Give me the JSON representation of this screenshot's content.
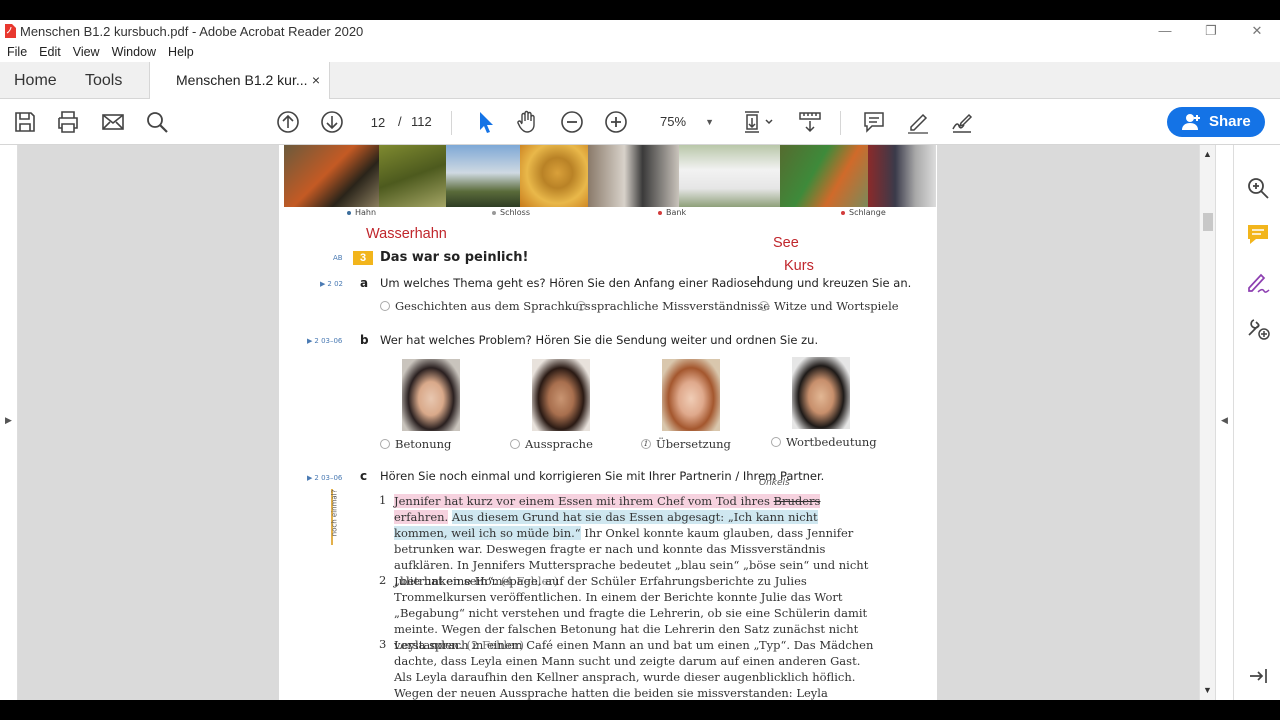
{
  "window": {
    "title": "Menschen B1.2 kursbuch.pdf - Adobe Acrobat Reader 2020",
    "controls": {
      "minimize": "—",
      "restore": "❐",
      "close": "✕"
    }
  },
  "menu": [
    "File",
    "Edit",
    "View",
    "Window",
    "Help"
  ],
  "tabs": {
    "home": "Home",
    "tools": "Tools",
    "document": "Menschen B1.2 kur...",
    "close": "×"
  },
  "toolbar": {
    "page_current": "12",
    "page_separator": "/",
    "page_total": "112",
    "zoom": "75%",
    "zoom_caret": "▼",
    "share_label": "Share",
    "icons": [
      "save-icon",
      "print-icon",
      "email-icon",
      "search-icon",
      "page-up-icon",
      "page-down-icon",
      "select-cursor-icon",
      "hand-tool-icon",
      "zoom-out-icon",
      "zoom-in-icon",
      "fit-page-icon",
      "scroll-mode-icon",
      "comment-icon",
      "highlight-pen-icon",
      "sign-icon"
    ]
  },
  "right_panel": {
    "icons": [
      "zoom-icon",
      "comment-panel-icon",
      "fill-sign-icon",
      "tools-icon",
      "collapse-panel-icon"
    ]
  },
  "colors": {
    "share_blue": "#1473e6",
    "annotation_red": "#c0262c",
    "exercise_orange": "#f2b51c",
    "highlight_pink": "#f6d2df",
    "highlight_blue": "#cfe7f0"
  },
  "document": {
    "photo_captions": [
      "Hahn",
      "Schloss",
      "Bank",
      "Schlange"
    ],
    "annotations": {
      "wasserhahn": "Wasserhahn",
      "see": "See",
      "kurs": "Kurs"
    },
    "exercise": {
      "ab_label": "AB",
      "number": "3",
      "title": "Das war so peinlich!",
      "a": {
        "track": "2 02",
        "letter": "a",
        "instruction": "Um welches Thema geht es? Hören Sie den Anfang einer Radiosendung und kreuzen Sie an.",
        "options": [
          "Geschichten aus dem Sprachkurs",
          "sprachliche Missverständnisse",
          "Witze und Wortspiele"
        ]
      },
      "b": {
        "track": "2 03–06",
        "letter": "b",
        "instruction": "Wer hat welches Problem? Hören Sie die Sendung weiter und ordnen Sie zu.",
        "options": [
          "Betonung",
          "Aussprache",
          "Übersetzung",
          "Wortbedeutung"
        ],
        "marked": "1"
      },
      "c": {
        "track": "2 03–06",
        "letter": "c",
        "instruction": "Hören Sie noch einmal und korrigieren Sie mit Ihrer Partnerin / Ihrem Partner.",
        "side_label": "noch einmal?",
        "handwritten": "Onkels",
        "p1": {
          "num": "1",
          "pink": "Jennifer hat kurz vor einem Essen mit ihrem Chef vom Tod ihres ",
          "strike": "Bruders",
          "pink_end": " erfahren.",
          "blue": "Aus diesem Grund hat sie das Essen abgesagt: „Ich kann nicht kommen, weil ich so müde bin.“",
          "rest": " Ihr Onkel konnte kaum glauben, dass Jennifer betrunken war. Deswegen fragte er nach und konnte das Missverständnis aufklären. In Jennifers Muttersprache bedeutet „blau sein“ „böse sein“ und nicht „betrunken sein“. ",
          "fehler": "(4 Fehler)"
        },
        "p2": {
          "num": "2",
          "text": "Julie hat eine Homepage, auf der Schüler Erfahrungsberichte zu Julies Trommelkursen veröffentlichen. In einem der Berichte konnte Julie das Wort „Begabung“ nicht verstehen und fragte die Lehrerin, ob sie eine Schülerin damit meinte. Wegen der falschen Betonung hat die Lehrerin den Satz zunächst nicht verstanden. ",
          "fehler": "(2 Fehler)"
        },
        "p3": {
          "num": "3",
          "text": "Leyla sprach in einem Café einen Mann an und bat um einen „Typ“. Das Mädchen dachte, dass Leyla einen Mann sucht und zeigte darum auf einen anderen Gast. Als Leyla daraufhin den Kellner ansprach, wurde dieser augenblicklich höflich. Wegen der neuen Aussprache hatten die beiden sie missverstanden: Leyla brauchte"
        }
      }
    }
  }
}
